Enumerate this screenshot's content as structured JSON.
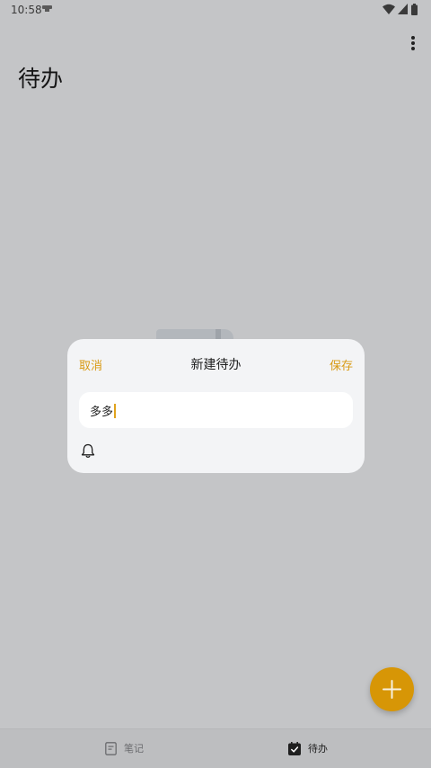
{
  "status_bar": {
    "time": "10:58",
    "icons": [
      "notification-icon",
      "wifi-icon",
      "signal-icon",
      "battery-icon"
    ]
  },
  "header": {
    "title": "待办",
    "menu_icon": "more-vert-icon"
  },
  "dialog": {
    "cancel_label": "取消",
    "title": "新建待办",
    "save_label": "保存",
    "input_value": "多多",
    "reminder_icon": "bell-icon"
  },
  "fab": {
    "icon": "plus-icon"
  },
  "bottom_nav": {
    "tabs": [
      {
        "label": "笔记",
        "icon": "note-icon",
        "active": false
      },
      {
        "label": "待办",
        "icon": "checkbox-icon",
        "active": true
      }
    ]
  },
  "colors": {
    "accent": "#d89a14",
    "fab": "#d79606",
    "scrim_background": "#c4c5c7",
    "dialog_background": "#f3f4f6"
  }
}
